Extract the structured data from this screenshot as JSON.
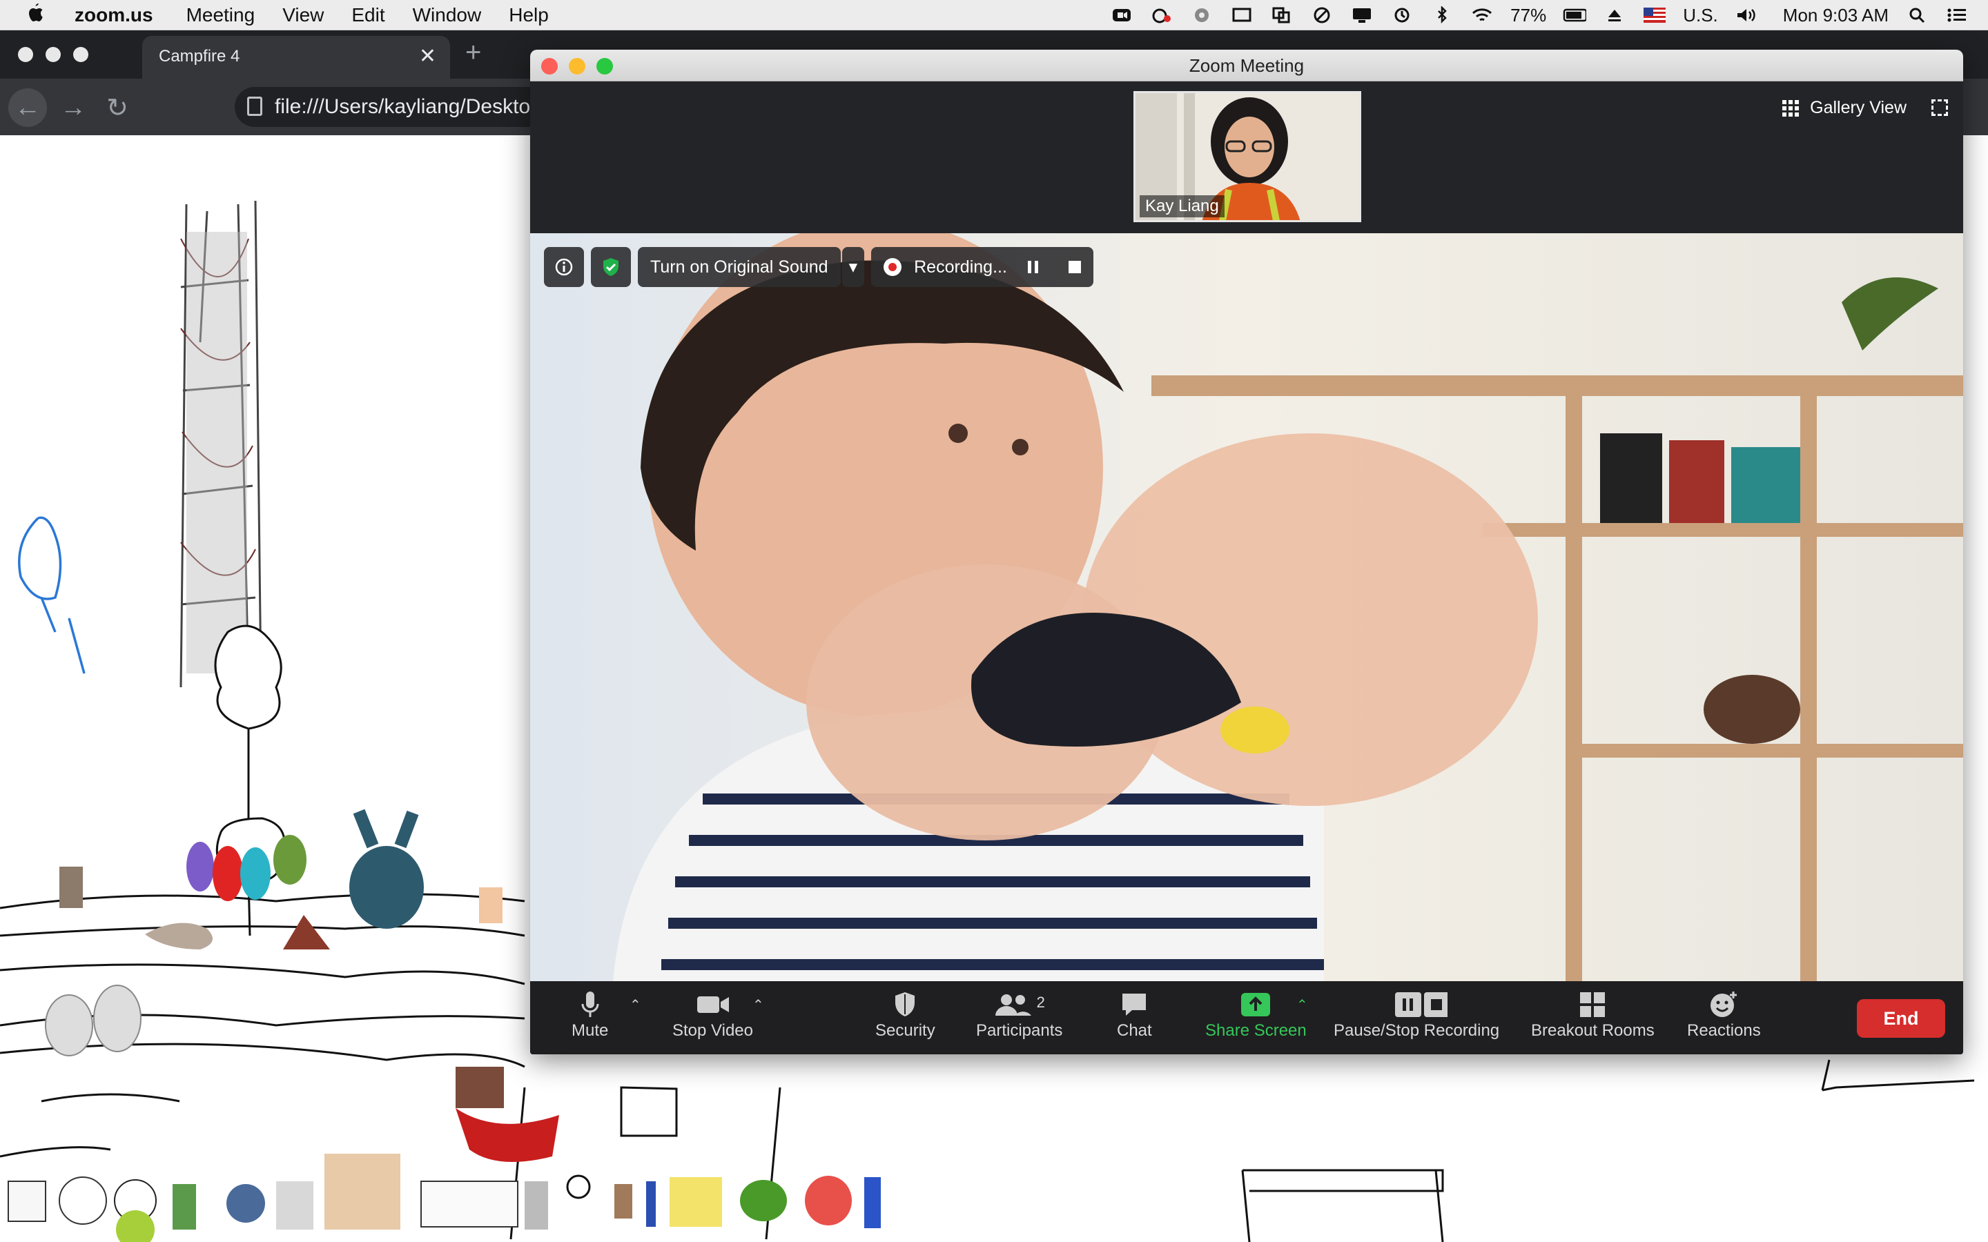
{
  "menubar": {
    "app_name": "zoom.us",
    "menus": [
      "Meeting",
      "View",
      "Edit",
      "Window",
      "Help"
    ],
    "battery": "77%",
    "input_source": "U.S.",
    "clock": "Mon 9:03 AM"
  },
  "browser": {
    "tab_title": "Campfire 4",
    "url": "file:///Users/kayliang/Desktop",
    "tab_close": "✕",
    "new_tab": "+"
  },
  "zoom": {
    "window_title": "Zoom Meeting",
    "gallery_view_label": "Gallery View",
    "thumbnail_name": "Kay Liang",
    "original_sound_label": "Turn on Original Sound",
    "recording_label": "Recording...",
    "toolbar": {
      "mute": "Mute",
      "stop_video": "Stop Video",
      "security": "Security",
      "participants": "Participants",
      "participants_count": "2",
      "chat": "Chat",
      "share_screen": "Share Screen",
      "pause_stop_recording": "Pause/Stop Recording",
      "breakout_rooms": "Breakout Rooms",
      "reactions": "Reactions",
      "end": "End"
    }
  },
  "colors": {
    "zoom_share_green": "#35c759",
    "zoom_end_red": "#d62d2d",
    "browser_dark": "#202124"
  }
}
